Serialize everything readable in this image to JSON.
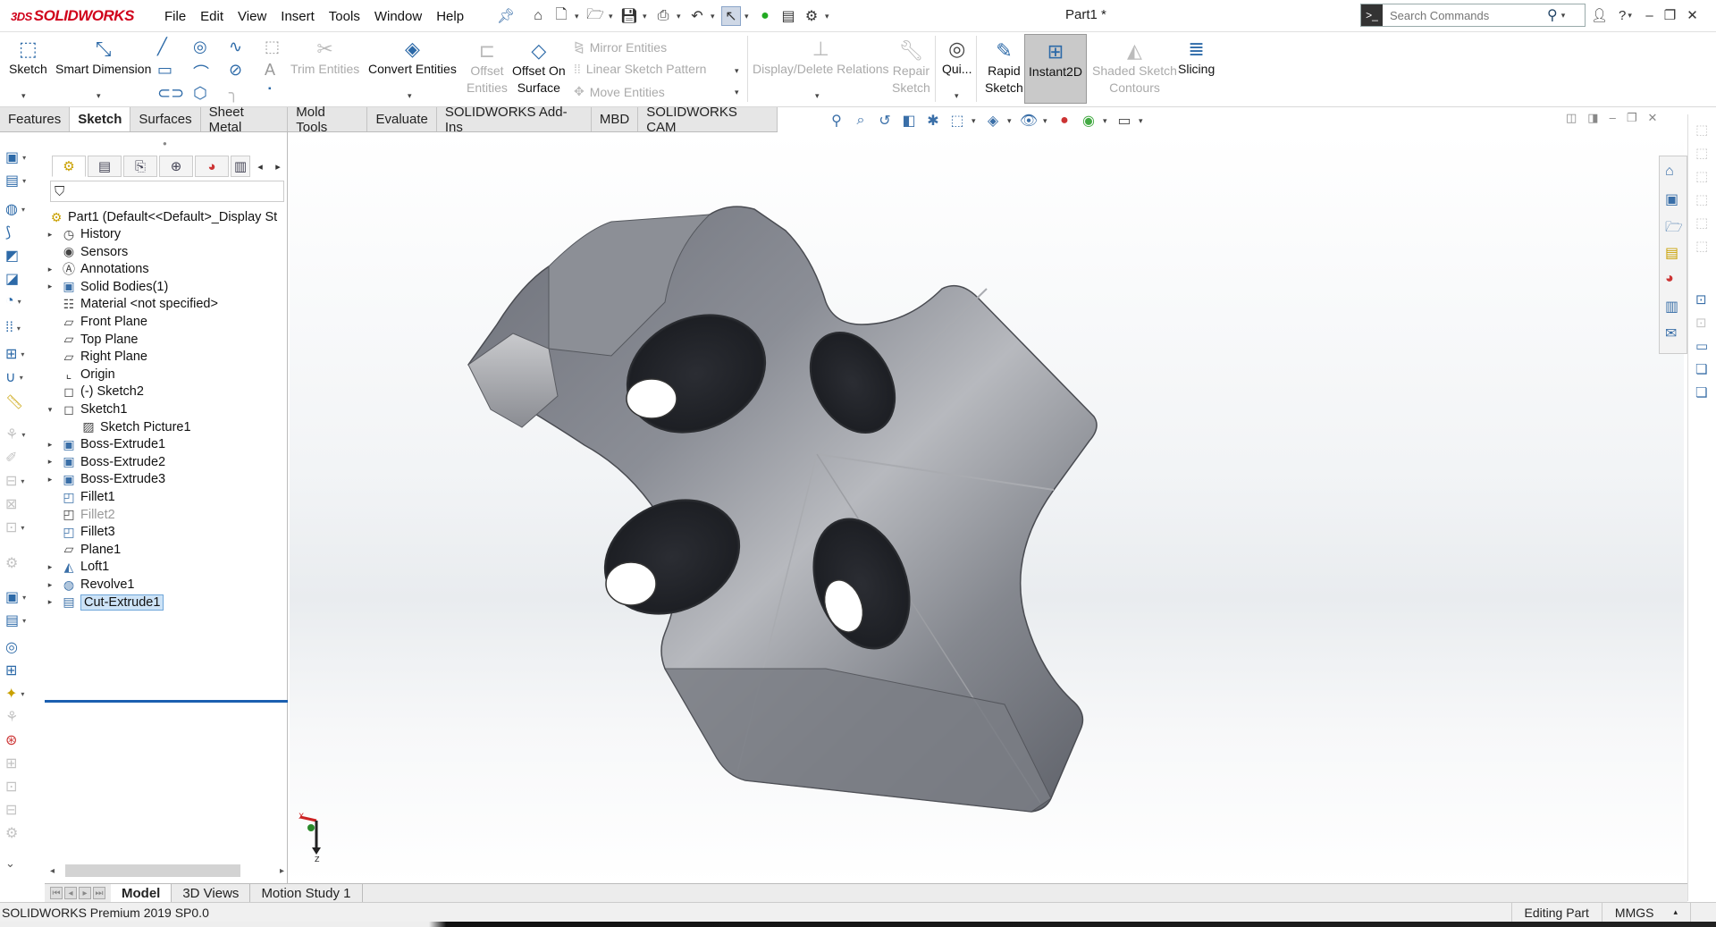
{
  "app": {
    "brand_prefix": "3DS",
    "brand": "SOLIDWORKS",
    "document_title": "Part1 *"
  },
  "menu": [
    "File",
    "Edit",
    "View",
    "Insert",
    "Tools",
    "Window",
    "Help"
  ],
  "search": {
    "placeholder": "Search Commands"
  },
  "ribbon": {
    "sketch": "Sketch",
    "smart_dimension": "Smart Dimension",
    "trim_entities": "Trim Entities",
    "convert_entities": "Convert Entities",
    "offset_entities_1": "Offset",
    "offset_entities_2": "Entities",
    "offset_on_surface_1": "Offset On",
    "offset_on_surface_2": "Surface",
    "mirror_entities": "Mirror Entities",
    "linear_sketch_pattern": "Linear Sketch Pattern",
    "move_entities": "Move Entities",
    "display_delete_relations": "Display/Delete Relations",
    "repair_sketch_1": "Repair",
    "repair_sketch_2": "Sketch",
    "quick_snaps": "Qui...",
    "rapid_sketch_1": "Rapid",
    "rapid_sketch_2": "Sketch",
    "instant2d": "Instant2D",
    "shaded_sketch_contours_1": "Shaded Sketch",
    "shaded_sketch_contours_2": "Contours",
    "slicing": "Slicing"
  },
  "command_tabs": [
    {
      "label": "Features",
      "active": false
    },
    {
      "label": "Sketch",
      "active": true
    },
    {
      "label": "Surfaces",
      "active": false
    },
    {
      "label": "Sheet Metal",
      "active": false
    },
    {
      "label": "Mold Tools",
      "active": false
    },
    {
      "label": "Evaluate",
      "active": false
    },
    {
      "label": "SOLIDWORKS Add-Ins",
      "active": false
    },
    {
      "label": "MBD",
      "active": false
    },
    {
      "label": "SOLIDWORKS CAM",
      "active": false
    }
  ],
  "tree": {
    "root": "Part1  (Default<<Default>_Display St",
    "items": [
      {
        "label": "History",
        "icon": "history-icon",
        "expand": true
      },
      {
        "label": "Sensors",
        "icon": "sensors-icon",
        "expand": false
      },
      {
        "label": "Annotations",
        "icon": "annotations-icon",
        "expand": true
      },
      {
        "label": "Solid Bodies(1)",
        "icon": "solid-bodies-icon",
        "expand": true
      },
      {
        "label": "Material <not specified>",
        "icon": "material-icon",
        "expand": false
      },
      {
        "label": "Front Plane",
        "icon": "plane-icon",
        "expand": false
      },
      {
        "label": "Top Plane",
        "icon": "plane-icon",
        "expand": false
      },
      {
        "label": "Right Plane",
        "icon": "plane-icon",
        "expand": false
      },
      {
        "label": "Origin",
        "icon": "origin-icon",
        "expand": false
      },
      {
        "label": "(-) Sketch2",
        "icon": "sketch-icon",
        "expand": false
      },
      {
        "label": "Sketch1",
        "icon": "sketch-icon",
        "expand": "open"
      },
      {
        "label": "Sketch Picture1",
        "icon": "sketch-picture-icon",
        "expand": false,
        "indent": true
      },
      {
        "label": "Boss-Extrude1",
        "icon": "boss-extrude-icon",
        "expand": true
      },
      {
        "label": "Boss-Extrude2",
        "icon": "boss-extrude-icon",
        "expand": true
      },
      {
        "label": "Boss-Extrude3",
        "icon": "boss-extrude-icon",
        "expand": true
      },
      {
        "label": "Fillet1",
        "icon": "fillet-icon",
        "expand": false
      },
      {
        "label": "Fillet2",
        "icon": "fillet-icon",
        "expand": false,
        "dim": true
      },
      {
        "label": "Fillet3",
        "icon": "fillet-icon",
        "expand": false
      },
      {
        "label": "Plane1",
        "icon": "plane-icon",
        "expand": false
      },
      {
        "label": "Loft1",
        "icon": "loft-icon",
        "expand": true
      },
      {
        "label": "Revolve1",
        "icon": "revolve-icon",
        "expand": true
      },
      {
        "label": "Cut-Extrude1",
        "icon": "cut-extrude-icon",
        "expand": true,
        "selected": true
      }
    ]
  },
  "bottom_tabs": [
    {
      "label": "Model",
      "active": true
    },
    {
      "label": "3D Views",
      "active": false
    },
    {
      "label": "Motion Study 1",
      "active": false
    }
  ],
  "status": {
    "version": "SOLIDWORKS Premium 2019 SP0.0",
    "mode": "Editing Part",
    "units": "MMGS",
    "units_caret": "▴"
  },
  "triad": {
    "x": "X",
    "z": "Z"
  },
  "colors": {
    "brand_red": "#d0021b",
    "accent_blue": "#2d6aa8",
    "selection": "#cde3f7",
    "rollback_bar": "#1b5fb0"
  }
}
